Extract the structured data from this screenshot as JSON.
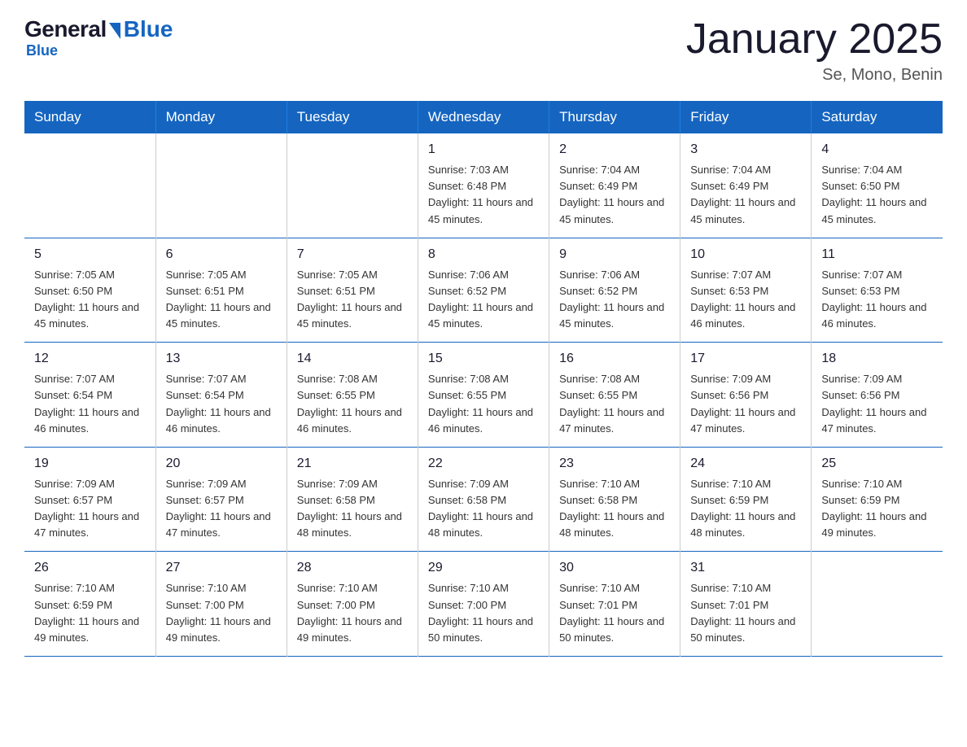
{
  "logo": {
    "general": "General",
    "blue": "Blue"
  },
  "title": "January 2025",
  "location": "Se, Mono, Benin",
  "weekdays": [
    "Sunday",
    "Monday",
    "Tuesday",
    "Wednesday",
    "Thursday",
    "Friday",
    "Saturday"
  ],
  "weeks": [
    [
      {
        "day": "",
        "info": ""
      },
      {
        "day": "",
        "info": ""
      },
      {
        "day": "",
        "info": ""
      },
      {
        "day": "1",
        "info": "Sunrise: 7:03 AM\nSunset: 6:48 PM\nDaylight: 11 hours and 45 minutes."
      },
      {
        "day": "2",
        "info": "Sunrise: 7:04 AM\nSunset: 6:49 PM\nDaylight: 11 hours and 45 minutes."
      },
      {
        "day": "3",
        "info": "Sunrise: 7:04 AM\nSunset: 6:49 PM\nDaylight: 11 hours and 45 minutes."
      },
      {
        "day": "4",
        "info": "Sunrise: 7:04 AM\nSunset: 6:50 PM\nDaylight: 11 hours and 45 minutes."
      }
    ],
    [
      {
        "day": "5",
        "info": "Sunrise: 7:05 AM\nSunset: 6:50 PM\nDaylight: 11 hours and 45 minutes."
      },
      {
        "day": "6",
        "info": "Sunrise: 7:05 AM\nSunset: 6:51 PM\nDaylight: 11 hours and 45 minutes."
      },
      {
        "day": "7",
        "info": "Sunrise: 7:05 AM\nSunset: 6:51 PM\nDaylight: 11 hours and 45 minutes."
      },
      {
        "day": "8",
        "info": "Sunrise: 7:06 AM\nSunset: 6:52 PM\nDaylight: 11 hours and 45 minutes."
      },
      {
        "day": "9",
        "info": "Sunrise: 7:06 AM\nSunset: 6:52 PM\nDaylight: 11 hours and 45 minutes."
      },
      {
        "day": "10",
        "info": "Sunrise: 7:07 AM\nSunset: 6:53 PM\nDaylight: 11 hours and 46 minutes."
      },
      {
        "day": "11",
        "info": "Sunrise: 7:07 AM\nSunset: 6:53 PM\nDaylight: 11 hours and 46 minutes."
      }
    ],
    [
      {
        "day": "12",
        "info": "Sunrise: 7:07 AM\nSunset: 6:54 PM\nDaylight: 11 hours and 46 minutes."
      },
      {
        "day": "13",
        "info": "Sunrise: 7:07 AM\nSunset: 6:54 PM\nDaylight: 11 hours and 46 minutes."
      },
      {
        "day": "14",
        "info": "Sunrise: 7:08 AM\nSunset: 6:55 PM\nDaylight: 11 hours and 46 minutes."
      },
      {
        "day": "15",
        "info": "Sunrise: 7:08 AM\nSunset: 6:55 PM\nDaylight: 11 hours and 46 minutes."
      },
      {
        "day": "16",
        "info": "Sunrise: 7:08 AM\nSunset: 6:55 PM\nDaylight: 11 hours and 47 minutes."
      },
      {
        "day": "17",
        "info": "Sunrise: 7:09 AM\nSunset: 6:56 PM\nDaylight: 11 hours and 47 minutes."
      },
      {
        "day": "18",
        "info": "Sunrise: 7:09 AM\nSunset: 6:56 PM\nDaylight: 11 hours and 47 minutes."
      }
    ],
    [
      {
        "day": "19",
        "info": "Sunrise: 7:09 AM\nSunset: 6:57 PM\nDaylight: 11 hours and 47 minutes."
      },
      {
        "day": "20",
        "info": "Sunrise: 7:09 AM\nSunset: 6:57 PM\nDaylight: 11 hours and 47 minutes."
      },
      {
        "day": "21",
        "info": "Sunrise: 7:09 AM\nSunset: 6:58 PM\nDaylight: 11 hours and 48 minutes."
      },
      {
        "day": "22",
        "info": "Sunrise: 7:09 AM\nSunset: 6:58 PM\nDaylight: 11 hours and 48 minutes."
      },
      {
        "day": "23",
        "info": "Sunrise: 7:10 AM\nSunset: 6:58 PM\nDaylight: 11 hours and 48 minutes."
      },
      {
        "day": "24",
        "info": "Sunrise: 7:10 AM\nSunset: 6:59 PM\nDaylight: 11 hours and 48 minutes."
      },
      {
        "day": "25",
        "info": "Sunrise: 7:10 AM\nSunset: 6:59 PM\nDaylight: 11 hours and 49 minutes."
      }
    ],
    [
      {
        "day": "26",
        "info": "Sunrise: 7:10 AM\nSunset: 6:59 PM\nDaylight: 11 hours and 49 minutes."
      },
      {
        "day": "27",
        "info": "Sunrise: 7:10 AM\nSunset: 7:00 PM\nDaylight: 11 hours and 49 minutes."
      },
      {
        "day": "28",
        "info": "Sunrise: 7:10 AM\nSunset: 7:00 PM\nDaylight: 11 hours and 49 minutes."
      },
      {
        "day": "29",
        "info": "Sunrise: 7:10 AM\nSunset: 7:00 PM\nDaylight: 11 hours and 50 minutes."
      },
      {
        "day": "30",
        "info": "Sunrise: 7:10 AM\nSunset: 7:01 PM\nDaylight: 11 hours and 50 minutes."
      },
      {
        "day": "31",
        "info": "Sunrise: 7:10 AM\nSunset: 7:01 PM\nDaylight: 11 hours and 50 minutes."
      },
      {
        "day": "",
        "info": ""
      }
    ]
  ]
}
